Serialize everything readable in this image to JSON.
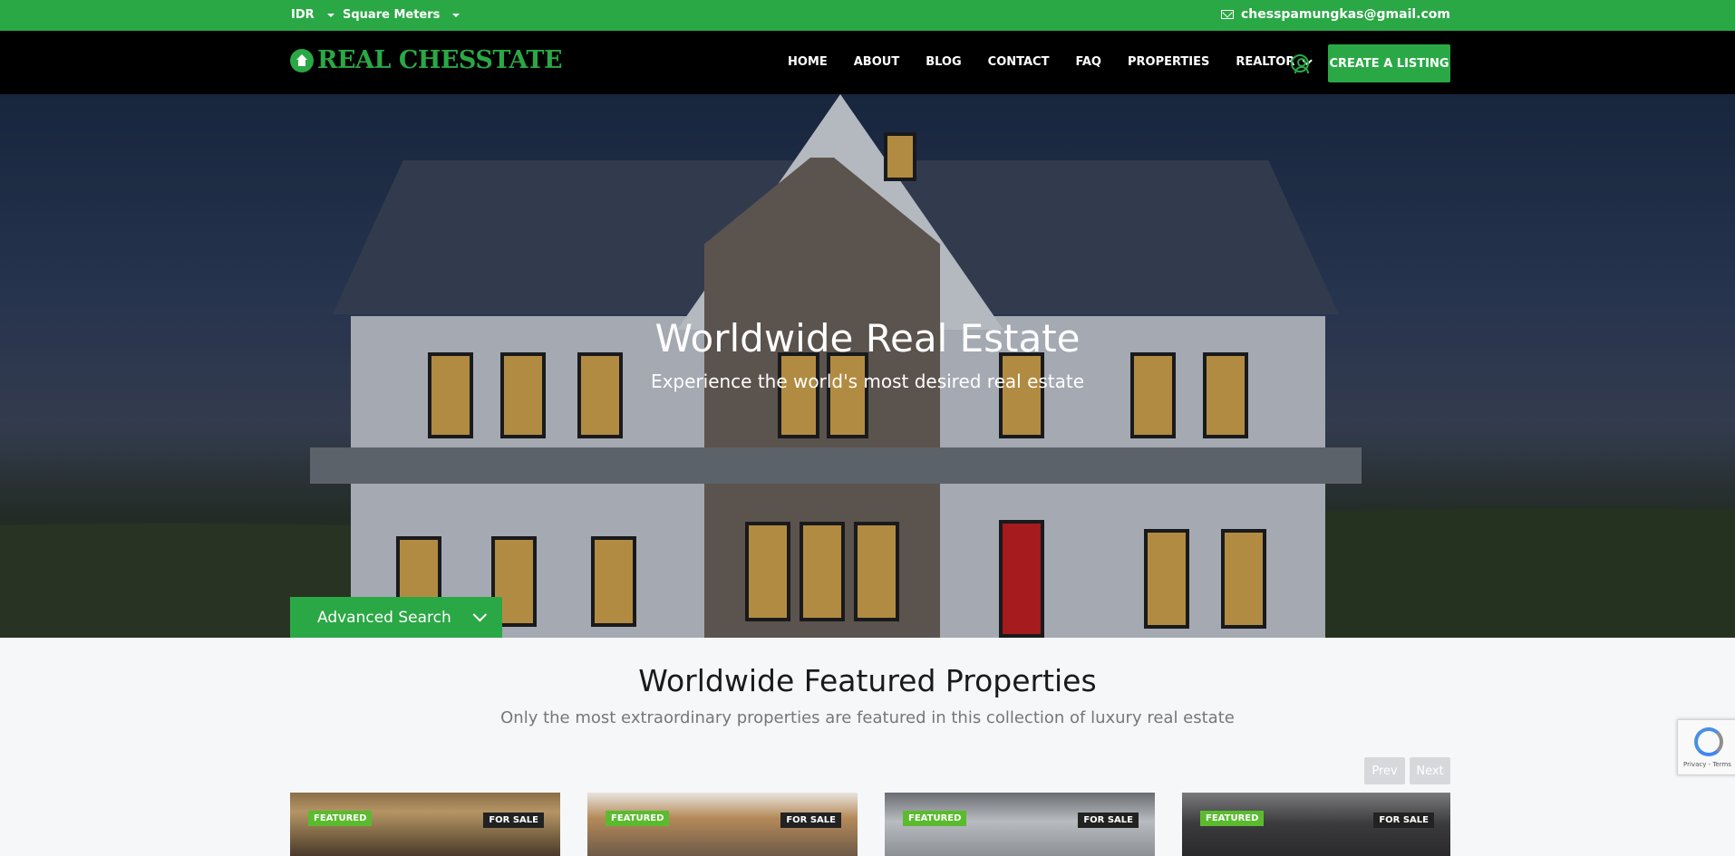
{
  "topbar": {
    "currency": "IDR",
    "unit": "Square Meters",
    "email": "chesspamungkas@gmail.com"
  },
  "header": {
    "logo_text": "REAL CHESSTATE",
    "nav": [
      "HOME",
      "ABOUT",
      "BLOG",
      "CONTACT",
      "FAQ",
      "PROPERTIES",
      "REALTOR"
    ],
    "cta": "CREATE A LISTING"
  },
  "hero": {
    "title": "Worldwide Real Estate",
    "subtitle": "Experience the world's most desired real estate",
    "advanced_search": "Advanced Search"
  },
  "featured": {
    "title": "Worldwide Featured Properties",
    "subtitle": "Only the most extraordinary properties are featured in this collection of luxury real estate",
    "prev": "Prev",
    "next": "Next",
    "cards": [
      {
        "badge": "FEATURED",
        "status": "FOR SALE"
      },
      {
        "badge": "FEATURED",
        "status": "FOR SALE"
      },
      {
        "badge": "FEATURED",
        "status": "FOR SALE"
      },
      {
        "badge": "FEATURED",
        "status": "FOR SALE"
      }
    ]
  },
  "recaptcha": {
    "text": "Privacy - Terms"
  },
  "colors": {
    "accent": "#2aa845",
    "nav_bg": "#000000",
    "featured_badge": "#5bbb2f"
  }
}
